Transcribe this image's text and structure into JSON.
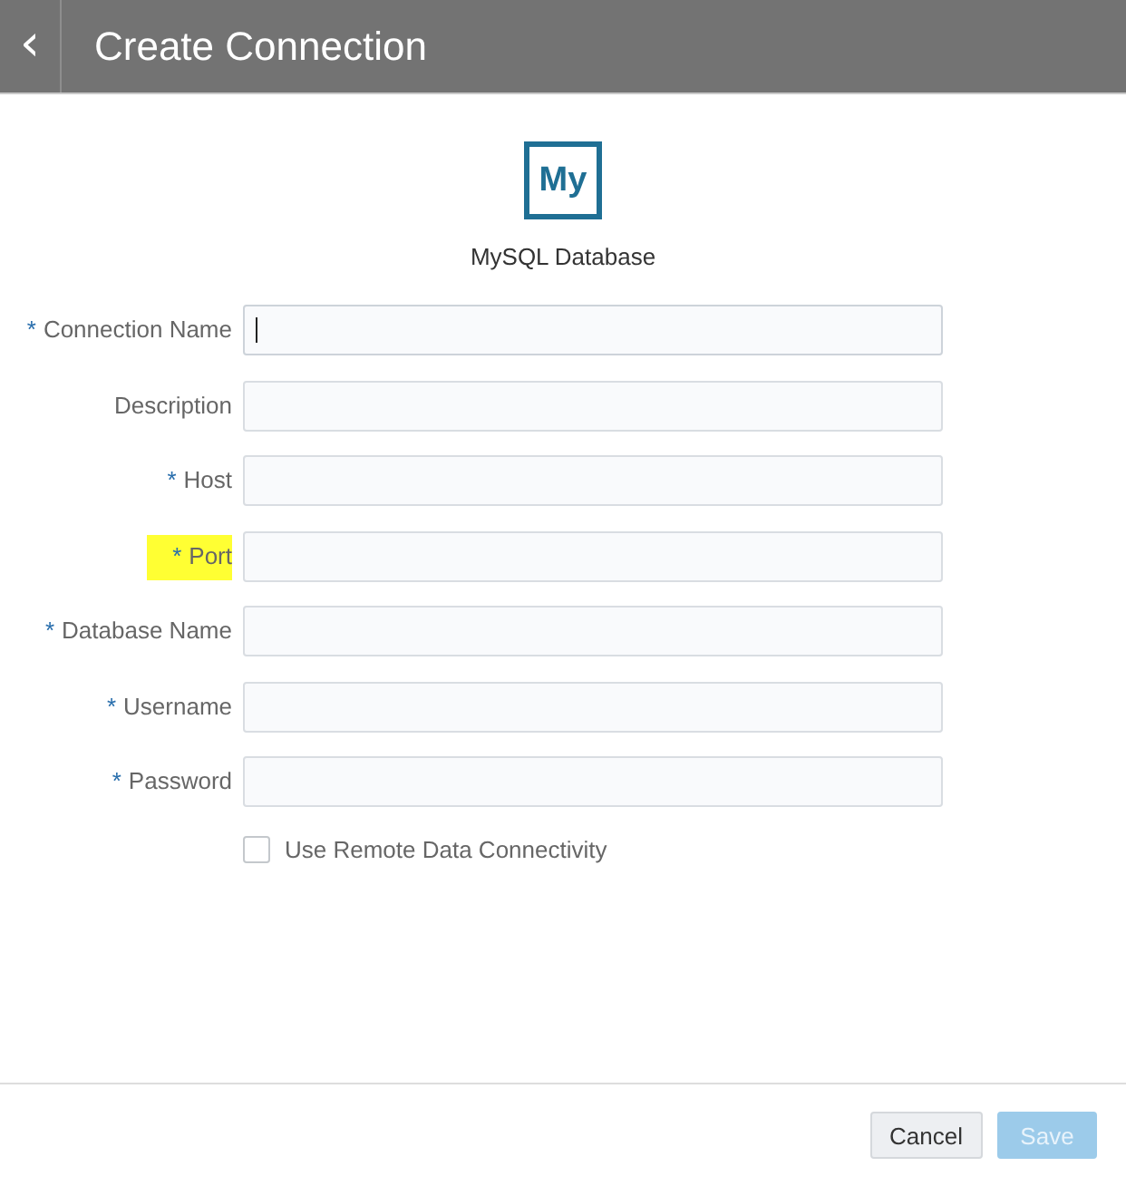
{
  "header": {
    "back_icon": "‹",
    "title": "Create Connection"
  },
  "source": {
    "logo": "My",
    "name": "MySQL Database"
  },
  "fields": [
    {
      "label": "Connection Name",
      "required": true,
      "focused": true,
      "highlighted": false
    },
    {
      "label": "Description",
      "required": false,
      "focused": false,
      "highlighted": false
    },
    {
      "label": "Host",
      "required": true,
      "focused": false,
      "highlighted": false
    },
    {
      "label": "Port",
      "required": true,
      "focused": false,
      "highlighted": true
    },
    {
      "label": "Database Name",
      "required": true,
      "focused": false,
      "highlighted": false
    },
    {
      "label": "Username",
      "required": true,
      "focused": false,
      "highlighted": false
    },
    {
      "label": "Password",
      "required": true,
      "focused": false,
      "highlighted": false
    }
  ],
  "required_mark": "*",
  "remote_option": {
    "label": "Use Remote Data Connectivity",
    "checked": false
  },
  "buttons": [
    {
      "label": "Cancel",
      "kind": "secondary",
      "disabled": false
    },
    {
      "label": "Save",
      "kind": "primary",
      "disabled": true
    }
  ]
}
